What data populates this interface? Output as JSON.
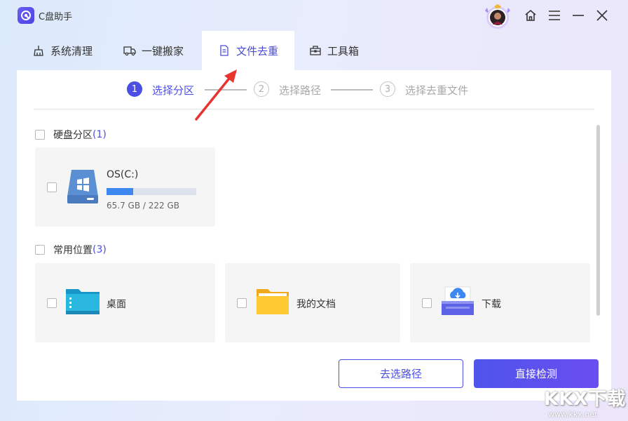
{
  "app": {
    "title": "C盘助手"
  },
  "tabs": [
    {
      "label": "系统清理",
      "icon": "broom-icon"
    },
    {
      "label": "一键搬家",
      "icon": "truck-icon"
    },
    {
      "label": "文件去重",
      "icon": "document-icon",
      "active": true
    },
    {
      "label": "工具箱",
      "icon": "toolbox-icon"
    }
  ],
  "steps": [
    {
      "num": "1",
      "label": "选择分区",
      "active": true
    },
    {
      "num": "2",
      "label": "选择路径",
      "active": false
    },
    {
      "num": "3",
      "label": "选择去重文件",
      "active": false
    }
  ],
  "disk_section": {
    "title": "硬盘分区",
    "count": "(1)"
  },
  "drives": [
    {
      "name": "OS(C:)",
      "size": "65.7 GB / 222 GB",
      "used_fraction": 0.296
    }
  ],
  "common_section": {
    "title": "常用位置",
    "count": "(3)"
  },
  "locations": [
    {
      "name": "桌面",
      "icon": "desktop-folder-icon"
    },
    {
      "name": "我的文档",
      "icon": "documents-folder-icon"
    },
    {
      "name": "下载",
      "icon": "download-folder-icon"
    }
  ],
  "buttons": {
    "choose_path": "去选路径",
    "direct_scan": "直接检测"
  },
  "watermark": {
    "text": "KKX下载",
    "url": "www.kkx.net"
  },
  "colors": {
    "accent": "#4b4fe3",
    "bar": "#3d87f0"
  }
}
